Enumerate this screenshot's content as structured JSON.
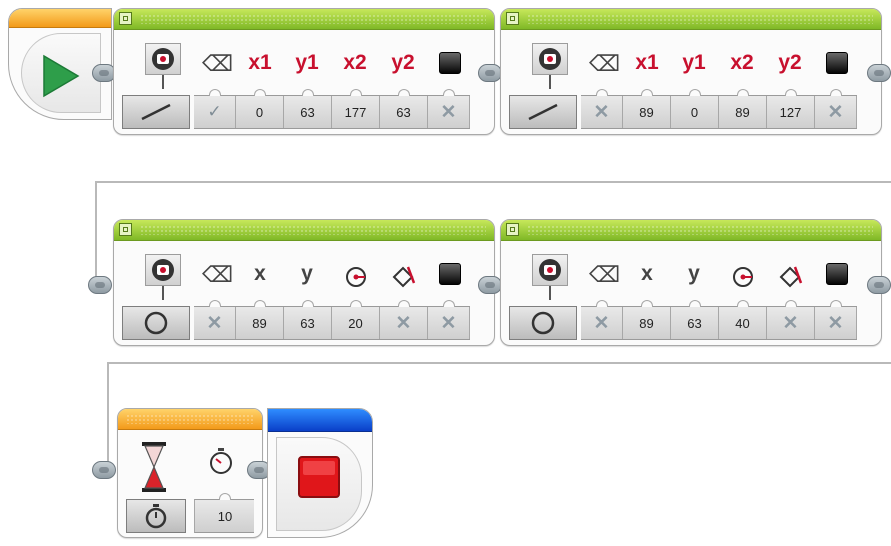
{
  "start_block": {
    "icon": "play-icon",
    "accent": "#2e9e4a"
  },
  "blocks": [
    {
      "mode": "line",
      "params": [
        "x1",
        "y1",
        "x2",
        "y2"
      ],
      "values": [
        "✓",
        "0",
        "63",
        "177",
        "63",
        "✕"
      ]
    },
    {
      "mode": "line",
      "params": [
        "x1",
        "y1",
        "x2",
        "y2"
      ],
      "values": [
        "✕",
        "89",
        "0",
        "89",
        "127",
        "✕"
      ]
    },
    {
      "mode": "circle",
      "params": [
        "x",
        "y"
      ],
      "values": [
        "✕",
        "89",
        "63",
        "20",
        "✕",
        "✕"
      ]
    },
    {
      "mode": "circle",
      "params": [
        "x",
        "y"
      ],
      "values": [
        "✕",
        "89",
        "63",
        "40",
        "✕",
        "✕"
      ]
    }
  ],
  "wait_block": {
    "mode_icon": "timer-icon",
    "value": "10"
  },
  "stop_block": {
    "icon": "stop-icon",
    "accent": "#e0161a"
  },
  "colors": {
    "green_bar": "#8dc63f",
    "orange_bar": "#f7a823",
    "blue_bar": "#1457e0",
    "param_red": "#c8102e"
  }
}
